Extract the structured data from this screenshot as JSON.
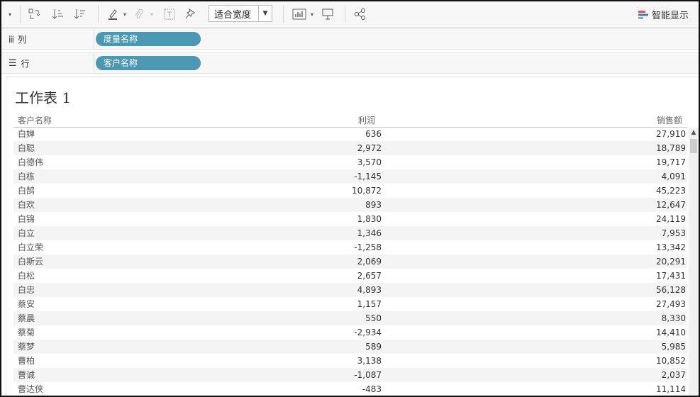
{
  "toolbar": {
    "fit_label": "适合宽度",
    "smart_label": "智能显示",
    "icons": [
      "dropdown-arrow",
      "swap-rows-columns",
      "sort-ascending",
      "sort-descending",
      "highlight-pen",
      "paperclip",
      "text-label",
      "pin",
      "chart-type",
      "presentation",
      "share"
    ]
  },
  "shelves": {
    "columns": {
      "label": "列",
      "pill": "度量名称"
    },
    "rows": {
      "label": "行",
      "pill": "客户名称"
    }
  },
  "sheet": {
    "title": "工作表 1",
    "headers": {
      "customer": "客户名称",
      "profit": "利润",
      "sales": "销售额"
    },
    "rows": [
      {
        "name": "白婵",
        "profit": "636",
        "sales": "27,910"
      },
      {
        "name": "白聪",
        "profit": "2,972",
        "sales": "18,789"
      },
      {
        "name": "白德伟",
        "profit": "3,570",
        "sales": "19,717"
      },
      {
        "name": "白栋",
        "profit": "-1,145",
        "sales": "4,091"
      },
      {
        "name": "白鹄",
        "profit": "10,872",
        "sales": "45,223"
      },
      {
        "name": "白欢",
        "profit": "893",
        "sales": "12,647"
      },
      {
        "name": "白锦",
        "profit": "1,830",
        "sales": "24,119"
      },
      {
        "name": "白立",
        "profit": "1,346",
        "sales": "7,953"
      },
      {
        "name": "白立荣",
        "profit": "-1,258",
        "sales": "13,342"
      },
      {
        "name": "白斯云",
        "profit": "2,069",
        "sales": "20,291"
      },
      {
        "name": "白松",
        "profit": "2,657",
        "sales": "17,431"
      },
      {
        "name": "白忠",
        "profit": "4,893",
        "sales": "56,128"
      },
      {
        "name": "蔡安",
        "profit": "1,157",
        "sales": "27,493"
      },
      {
        "name": "蔡晨",
        "profit": "550",
        "sales": "8,330"
      },
      {
        "name": "蔡菊",
        "profit": "-2,934",
        "sales": "14,410"
      },
      {
        "name": "蔡梦",
        "profit": "589",
        "sales": "5,985"
      },
      {
        "name": "曹柏",
        "profit": "3,138",
        "sales": "10,852"
      },
      {
        "name": "曹诚",
        "profit": "-1,087",
        "sales": "2,037"
      },
      {
        "name": "曹达侠",
        "profit": "-483",
        "sales": "11,114"
      }
    ]
  }
}
